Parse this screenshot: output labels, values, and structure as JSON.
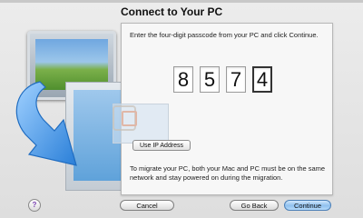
{
  "window": {
    "title": "Connect to Your PC"
  },
  "instruction": "Enter the four-digit passcode from your PC and click Continue.",
  "passcode": {
    "digits": [
      "8",
      "5",
      "7",
      "4"
    ],
    "active_index": 3
  },
  "ip_button": "Use IP Address",
  "migrate_note": "To migrate your PC, both your Mac and PC must be on the same network and stay powered on during the migration.",
  "buttons": {
    "help": "?",
    "cancel": "Cancel",
    "go_back": "Go Back",
    "continue": "Continue"
  },
  "colors": {
    "continue_button": "#8fc0ee",
    "arrow": "#3b8de0",
    "help_glyph": "#7a3fb3"
  }
}
